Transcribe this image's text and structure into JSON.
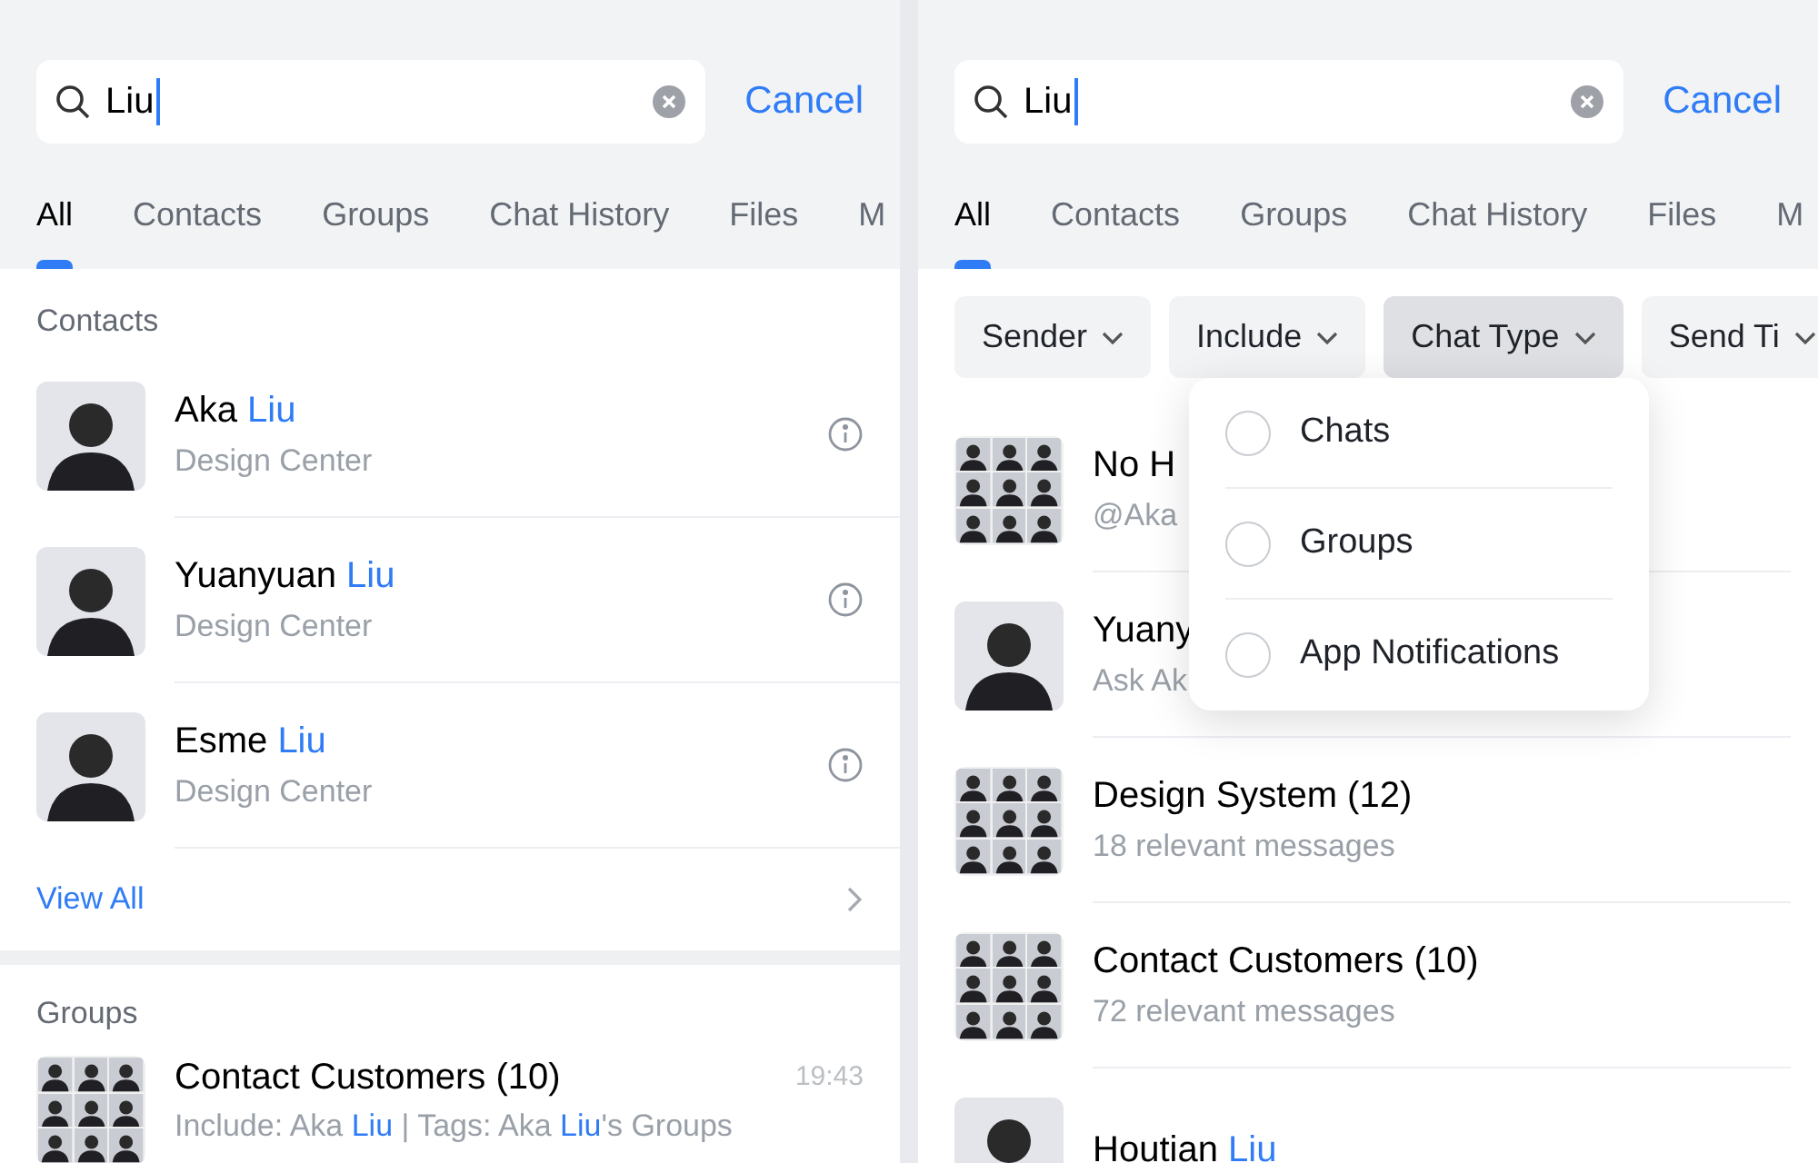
{
  "left": {
    "search": {
      "value": "Liu"
    },
    "cancel": "Cancel",
    "tabs": [
      {
        "label": "All",
        "selected": true
      },
      {
        "label": "Contacts",
        "selected": false
      },
      {
        "label": "Groups",
        "selected": false
      },
      {
        "label": "Chat History",
        "selected": false
      },
      {
        "label": "Files",
        "selected": false
      },
      {
        "label": "M",
        "selected": false
      }
    ],
    "contacts": {
      "heading": "Contacts",
      "items": [
        {
          "kind": "person",
          "name": [
            {
              "text": "Aka ",
              "highlight": false
            },
            {
              "text": "Liu",
              "highlight": true
            }
          ],
          "subtitle": "Design Center"
        },
        {
          "kind": "person",
          "name": [
            {
              "text": "Yuanyuan ",
              "highlight": false
            },
            {
              "text": "Liu",
              "highlight": true
            }
          ],
          "subtitle": "Design Center"
        },
        {
          "kind": "person",
          "name": [
            {
              "text": "Esme ",
              "highlight": false
            },
            {
              "text": "Liu",
              "highlight": true
            }
          ],
          "subtitle": "Design Center"
        }
      ],
      "view_all": "View All"
    },
    "groups": {
      "heading": "Groups",
      "items": [
        {
          "kind": "group",
          "title": "Contact Customers (10)",
          "time": "19:43",
          "subtitle": [
            {
              "text": "Include: Aka ",
              "highlight": false
            },
            {
              "text": "Liu",
              "highlight": true
            },
            {
              "text": " | Tags: Aka ",
              "highlight": false
            },
            {
              "text": "Liu",
              "highlight": true
            },
            {
              "text": "'s Groups",
              "highlight": false
            }
          ]
        }
      ]
    }
  },
  "right": {
    "search": {
      "value": "Liu"
    },
    "cancel": "Cancel",
    "tabs": [
      {
        "label": "All",
        "selected": true
      },
      {
        "label": "Contacts",
        "selected": false
      },
      {
        "label": "Groups",
        "selected": false
      },
      {
        "label": "Chat History",
        "selected": false
      },
      {
        "label": "Files",
        "selected": false
      },
      {
        "label": "M",
        "selected": false
      }
    ],
    "filters": [
      {
        "label": "Sender",
        "selected": false
      },
      {
        "label": "Include",
        "selected": false
      },
      {
        "label": "Chat Type",
        "selected": true
      },
      {
        "label": "Send Ti",
        "selected": false
      }
    ],
    "dropdown": {
      "options": [
        {
          "label": "Chats",
          "selected": false
        },
        {
          "label": "Groups",
          "selected": false
        },
        {
          "label": "App Notifications",
          "selected": false
        }
      ]
    },
    "results": [
      {
        "kind": "group",
        "title": [
          {
            "text": "No H",
            "highlight": false
          }
        ],
        "subtitle": "@Aka"
      },
      {
        "kind": "person",
        "title": [
          {
            "text": "Yuany",
            "highlight": false
          }
        ],
        "subtitle": "Ask Ak"
      },
      {
        "kind": "group",
        "title": [
          {
            "text": "Design System (12)",
            "highlight": false
          }
        ],
        "subtitle": "18 relevant messages"
      },
      {
        "kind": "group",
        "title": [
          {
            "text": "Contact Customers (10)",
            "highlight": false
          }
        ],
        "subtitle": "72 relevant messages"
      },
      {
        "kind": "person",
        "title": [
          {
            "text": "Houtian ",
            "highlight": false
          },
          {
            "text": "Liu",
            "highlight": true
          }
        ]
      }
    ]
  }
}
